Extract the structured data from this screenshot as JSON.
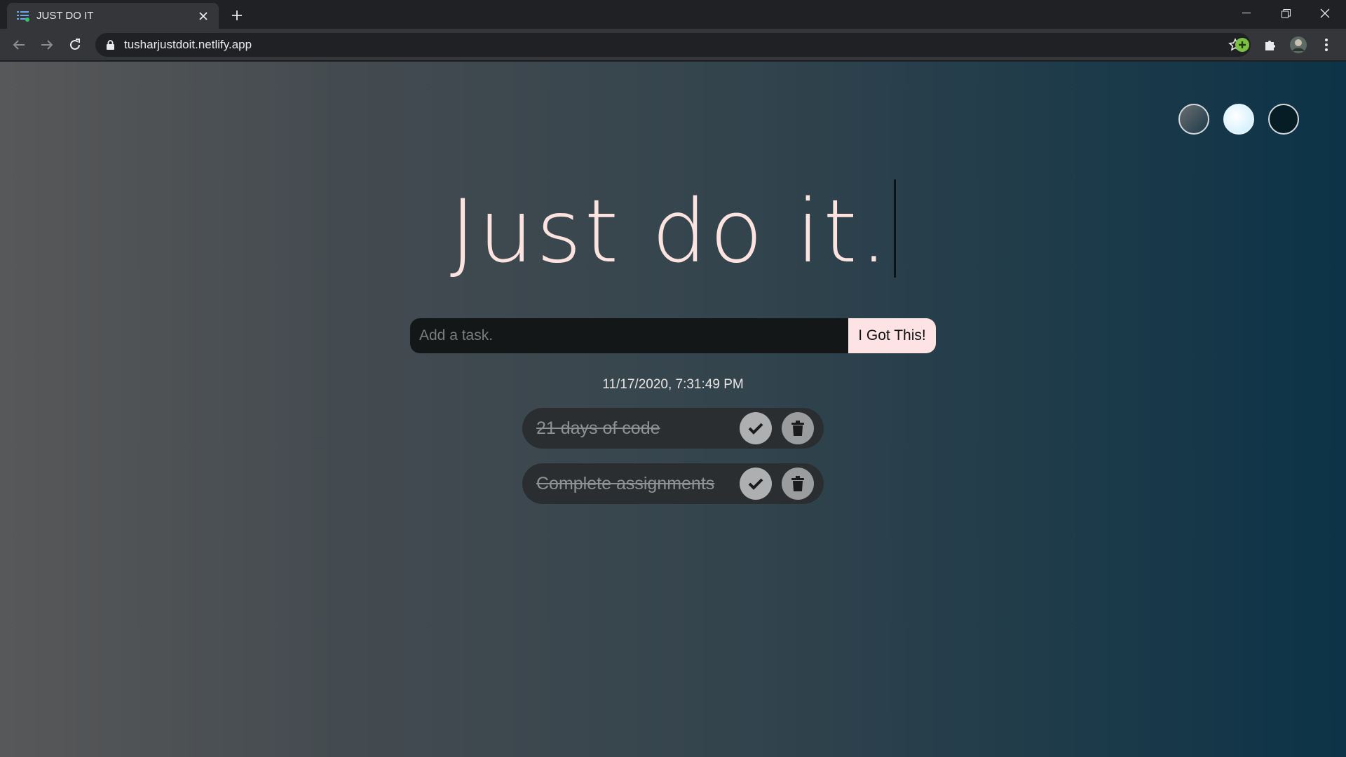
{
  "browser": {
    "tab_title": "JUST DO IT",
    "url": "tusharjustdoit.netlify.app"
  },
  "page": {
    "heading": "Just do it.",
    "input_placeholder": "Add a task.",
    "submit_label": "I Got This!",
    "timestamp": "11/17/2020, 7:31:49 PM",
    "themes": [
      "standard",
      "light",
      "darker"
    ],
    "todos": [
      {
        "text": "21 days of code",
        "completed": true
      },
      {
        "text": "Complete assignments",
        "completed": true
      }
    ]
  }
}
